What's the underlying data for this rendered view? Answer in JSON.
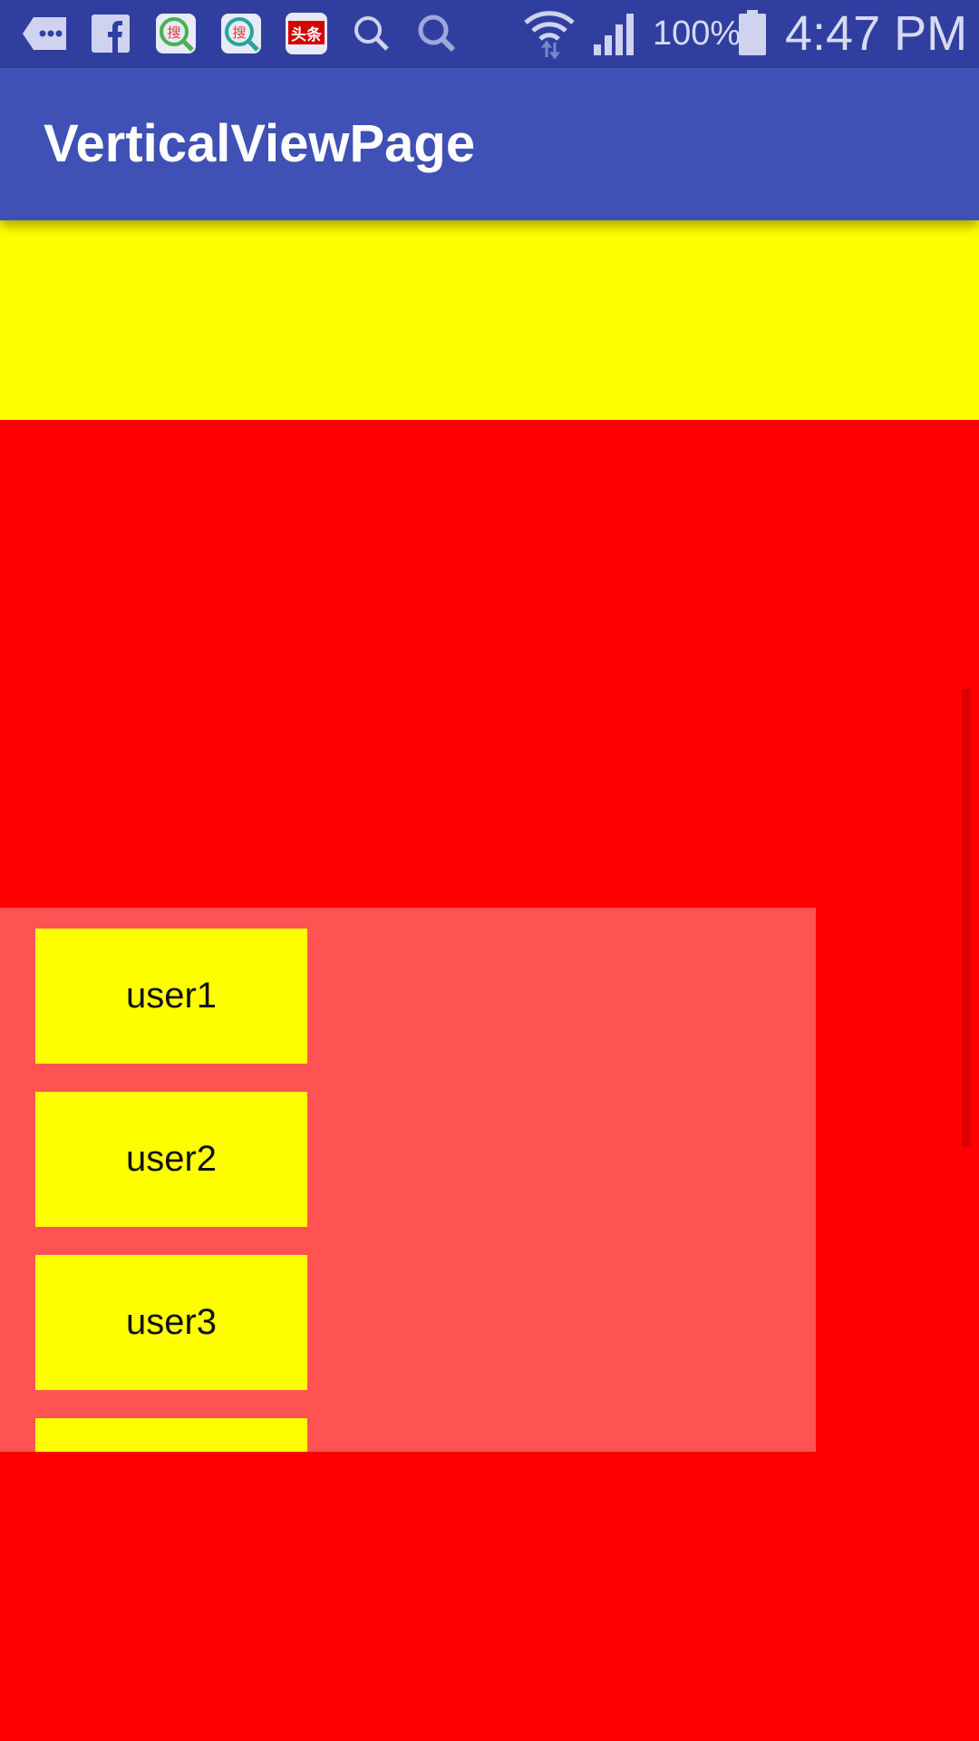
{
  "status_bar": {
    "icons": [
      "messages-icon",
      "facebook-icon",
      "sogou-search-icon",
      "sogou-search-icon",
      "toutiao-icon",
      "search-icon",
      "search-icon",
      "wifi-icon",
      "signal-icon",
      "battery-icon"
    ],
    "toutiao_label": "头条",
    "sogou_label": "搜",
    "battery_percent": "100%",
    "time": "4:47 PM"
  },
  "app_bar": {
    "title": "VerticalViewPage"
  },
  "colors": {
    "status_bar": "#303f9f",
    "app_bar": "#3f51b5",
    "page_background": "#ff0000",
    "band": "#ffff00",
    "overlay": "#ff5252",
    "card": "#ffff00"
  },
  "users": {
    "items": [
      {
        "label": "user1"
      },
      {
        "label": "user2"
      },
      {
        "label": "user3"
      },
      {
        "label": ""
      }
    ]
  }
}
